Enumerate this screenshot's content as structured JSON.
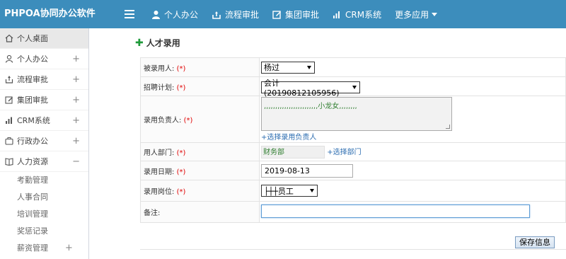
{
  "app": {
    "title": "PHPOA协同办公软件"
  },
  "topnav": {
    "items": [
      {
        "label": "个人办公",
        "icon": "user-icon"
      },
      {
        "label": "流程审批",
        "icon": "flow-icon"
      },
      {
        "label": "集团审批",
        "icon": "edit-icon"
      },
      {
        "label": "CRM系统",
        "icon": "bar-chart-icon"
      }
    ],
    "more_label": "更多应用"
  },
  "sidebar": {
    "items": [
      {
        "label": "个人桌面",
        "icon": "home-icon",
        "toggle": ""
      },
      {
        "label": "个人办公",
        "icon": "user-icon",
        "toggle": "+"
      },
      {
        "label": "流程审批",
        "icon": "flow-icon",
        "toggle": "+"
      },
      {
        "label": "集团审批",
        "icon": "edit-icon",
        "toggle": "+"
      },
      {
        "label": "CRM系统",
        "icon": "bar-chart-icon",
        "toggle": "+"
      },
      {
        "label": "行政办公",
        "icon": "briefcase-icon",
        "toggle": "+"
      },
      {
        "label": "人力资源",
        "icon": "book-icon",
        "toggle": "−"
      }
    ],
    "subitems": [
      {
        "label": "考勤管理",
        "toggle": ""
      },
      {
        "label": "人事合同",
        "toggle": ""
      },
      {
        "label": "培训管理",
        "toggle": ""
      },
      {
        "label": "奖惩记录",
        "toggle": ""
      },
      {
        "label": "薪资管理",
        "toggle": "+"
      }
    ]
  },
  "page": {
    "title": "人才录用",
    "plus_glyph": "✚",
    "required_mark": "(*)",
    "fields": {
      "hiree": {
        "label": "被录用人:",
        "value": "杨过"
      },
      "plan": {
        "label": "招聘计划:",
        "value": "会计(20190812105956)"
      },
      "manager": {
        "label": "录用负责人:",
        "value": ",,,,,,,,,,,,,,,,,,,,,,,,小龙女,,,,,,,,",
        "link": "+选择录用负责人"
      },
      "dept": {
        "label": "用人部门:",
        "value": "财务部",
        "link": "+选择部门"
      },
      "date": {
        "label": "录用日期:",
        "value": "2019-08-13"
      },
      "position": {
        "label": "录用岗位:",
        "value": "├┼┼员工"
      },
      "note": {
        "label": "备注:",
        "value": ""
      }
    },
    "save_label": "保存信息"
  },
  "colors": {
    "topbar": "#3c8dbc",
    "required": "#e00000",
    "link": "#2b6cb0",
    "accent_green": "#1f9a3a"
  }
}
